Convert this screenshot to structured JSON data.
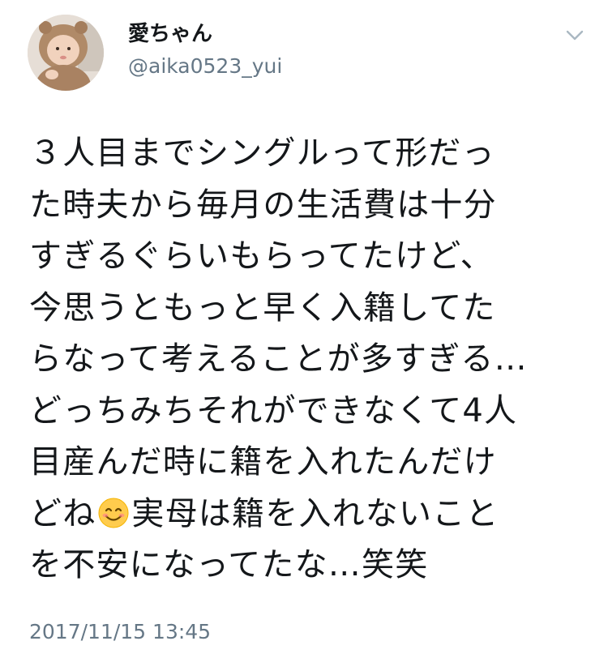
{
  "tweet": {
    "display_name": "愛ちゃん",
    "handle": "@aika0523_yui",
    "avatar_icon": "baby-in-bear-hood-avatar",
    "menu_icon": "chevron-down-icon",
    "text_lines": [
      "３人目までシングルって形だっ",
      "た時夫から毎月の生活費は十分",
      "すぎるぐらいもらってたけど、",
      "今思うともっと早く入籍してた",
      "らなって考えることが多すぎる…",
      "どっちみちそれができなくて4人",
      "目産んだ時に籍を入れたんだけ",
      "実母は籍を入れないこと",
      "を不安になってたな…笑笑"
    ],
    "line8_prefix": "どね",
    "emoji_icon": "smiling-face-emoji",
    "timestamp": "2017/11/15 13:45"
  },
  "colors": {
    "text": "#14171a",
    "secondary": "#657786",
    "caret": "#aab8c2",
    "background": "#ffffff"
  }
}
